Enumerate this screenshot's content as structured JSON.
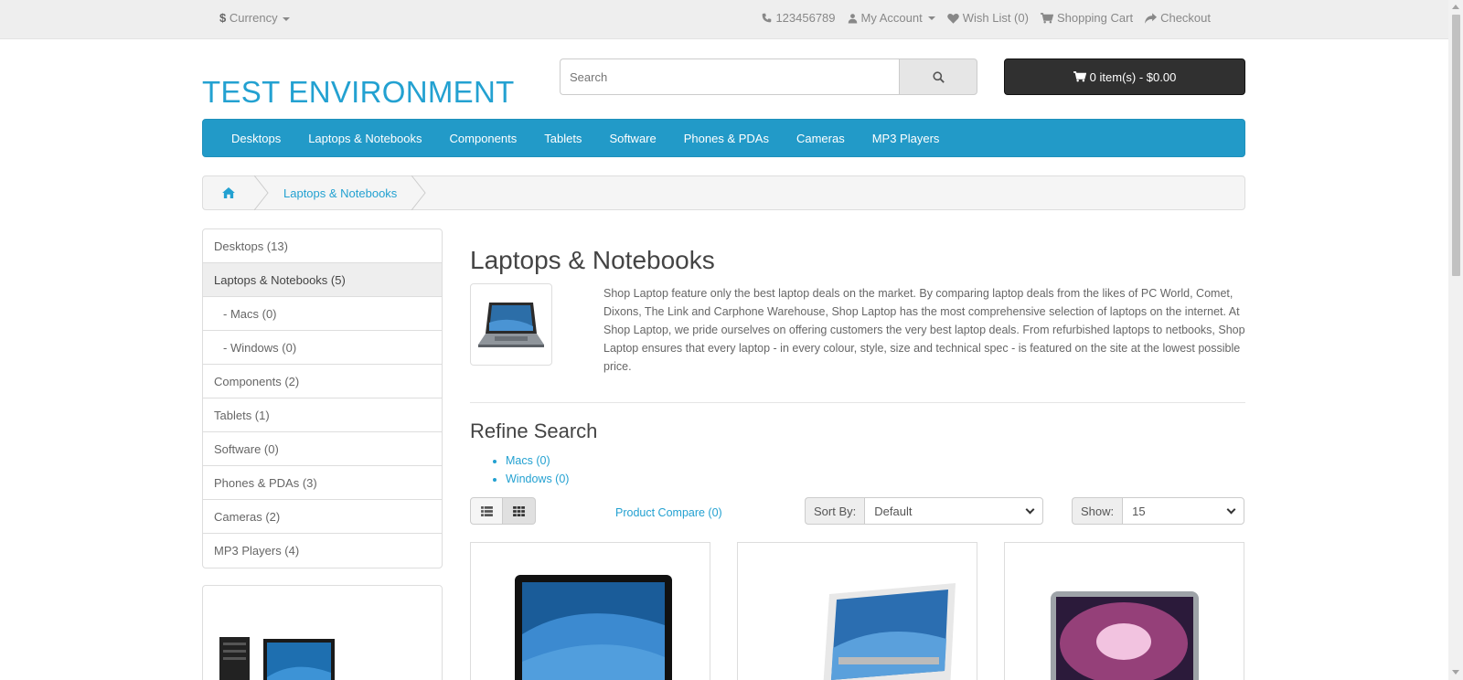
{
  "topbar": {
    "currency_symbol": "$",
    "currency_label": "Currency",
    "phone": "123456789",
    "my_account": "My Account",
    "wishlist": "Wish List (0)",
    "shopping_cart": "Shopping Cart",
    "checkout": "Checkout"
  },
  "header": {
    "logo": "TEST ENVIRONMENT",
    "search_placeholder": "Search",
    "cart_label": "0 item(s) - $0.00"
  },
  "menu": {
    "items": [
      "Desktops",
      "Laptops & Notebooks",
      "Components",
      "Tablets",
      "Software",
      "Phones & PDAs",
      "Cameras",
      "MP3 Players"
    ]
  },
  "breadcrumb": {
    "current": "Laptops & Notebooks"
  },
  "sidebar": {
    "items": [
      {
        "label": "Desktops (13)"
      },
      {
        "label": "Laptops & Notebooks (5)"
      },
      {
        "label": "- Macs (0)"
      },
      {
        "label": "- Windows (0)"
      },
      {
        "label": "Components (2)"
      },
      {
        "label": "Tablets (1)"
      },
      {
        "label": "Software (0)"
      },
      {
        "label": "Phones & PDAs (3)"
      },
      {
        "label": "Cameras (2)"
      },
      {
        "label": "MP3 Players (4)"
      }
    ]
  },
  "main": {
    "title": "Laptops & Notebooks",
    "description": "Shop Laptop feature only the best laptop deals on the market. By comparing laptop deals from the likes of PC World, Comet, Dixons, The Link and Carphone Warehouse, Shop Laptop has the most comprehensive selection of laptops on the internet. At Shop Laptop, we pride ourselves on offering customers the very best laptop deals. From refurbished laptops to netbooks, Shop Laptop ensures that every laptop - in every colour, style, size and technical spec - is featured on the site at the lowest possible price.",
    "refine_title": "Refine Search",
    "refine_links": [
      "Macs (0)",
      "Windows (0)"
    ],
    "product_compare": "Product Compare (0)",
    "sort_label": "Sort By:",
    "sort_value": "Default",
    "show_label": "Show:",
    "show_value": "15"
  },
  "colors": {
    "accent": "#229ac8",
    "link": "#23a1d1",
    "cart_bg": "#303030"
  }
}
